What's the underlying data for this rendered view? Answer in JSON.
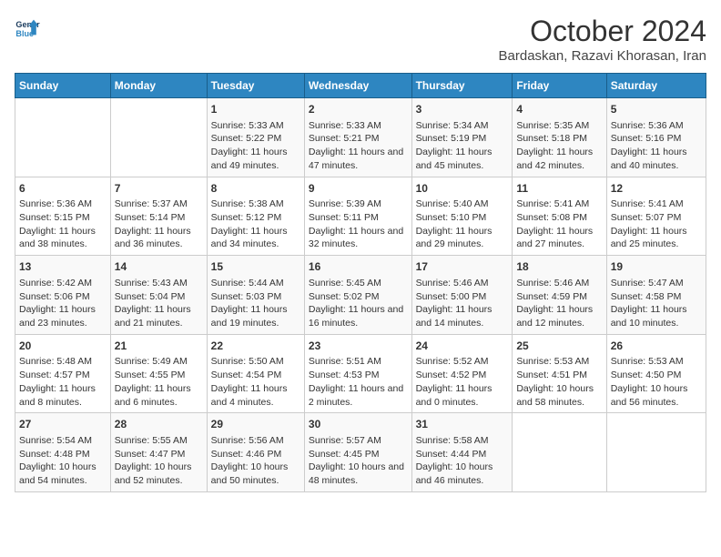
{
  "header": {
    "logo_line1": "General",
    "logo_line2": "Blue",
    "month": "October 2024",
    "location": "Bardaskan, Razavi Khorasan, Iran"
  },
  "weekdays": [
    "Sunday",
    "Monday",
    "Tuesday",
    "Wednesday",
    "Thursday",
    "Friday",
    "Saturday"
  ],
  "weeks": [
    [
      {
        "day": "",
        "content": ""
      },
      {
        "day": "",
        "content": ""
      },
      {
        "day": "1",
        "content": "Sunrise: 5:33 AM\nSunset: 5:22 PM\nDaylight: 11 hours and 49 minutes."
      },
      {
        "day": "2",
        "content": "Sunrise: 5:33 AM\nSunset: 5:21 PM\nDaylight: 11 hours and 47 minutes."
      },
      {
        "day": "3",
        "content": "Sunrise: 5:34 AM\nSunset: 5:19 PM\nDaylight: 11 hours and 45 minutes."
      },
      {
        "day": "4",
        "content": "Sunrise: 5:35 AM\nSunset: 5:18 PM\nDaylight: 11 hours and 42 minutes."
      },
      {
        "day": "5",
        "content": "Sunrise: 5:36 AM\nSunset: 5:16 PM\nDaylight: 11 hours and 40 minutes."
      }
    ],
    [
      {
        "day": "6",
        "content": "Sunrise: 5:36 AM\nSunset: 5:15 PM\nDaylight: 11 hours and 38 minutes."
      },
      {
        "day": "7",
        "content": "Sunrise: 5:37 AM\nSunset: 5:14 PM\nDaylight: 11 hours and 36 minutes."
      },
      {
        "day": "8",
        "content": "Sunrise: 5:38 AM\nSunset: 5:12 PM\nDaylight: 11 hours and 34 minutes."
      },
      {
        "day": "9",
        "content": "Sunrise: 5:39 AM\nSunset: 5:11 PM\nDaylight: 11 hours and 32 minutes."
      },
      {
        "day": "10",
        "content": "Sunrise: 5:40 AM\nSunset: 5:10 PM\nDaylight: 11 hours and 29 minutes."
      },
      {
        "day": "11",
        "content": "Sunrise: 5:41 AM\nSunset: 5:08 PM\nDaylight: 11 hours and 27 minutes."
      },
      {
        "day": "12",
        "content": "Sunrise: 5:41 AM\nSunset: 5:07 PM\nDaylight: 11 hours and 25 minutes."
      }
    ],
    [
      {
        "day": "13",
        "content": "Sunrise: 5:42 AM\nSunset: 5:06 PM\nDaylight: 11 hours and 23 minutes."
      },
      {
        "day": "14",
        "content": "Sunrise: 5:43 AM\nSunset: 5:04 PM\nDaylight: 11 hours and 21 minutes."
      },
      {
        "day": "15",
        "content": "Sunrise: 5:44 AM\nSunset: 5:03 PM\nDaylight: 11 hours and 19 minutes."
      },
      {
        "day": "16",
        "content": "Sunrise: 5:45 AM\nSunset: 5:02 PM\nDaylight: 11 hours and 16 minutes."
      },
      {
        "day": "17",
        "content": "Sunrise: 5:46 AM\nSunset: 5:00 PM\nDaylight: 11 hours and 14 minutes."
      },
      {
        "day": "18",
        "content": "Sunrise: 5:46 AM\nSunset: 4:59 PM\nDaylight: 11 hours and 12 minutes."
      },
      {
        "day": "19",
        "content": "Sunrise: 5:47 AM\nSunset: 4:58 PM\nDaylight: 11 hours and 10 minutes."
      }
    ],
    [
      {
        "day": "20",
        "content": "Sunrise: 5:48 AM\nSunset: 4:57 PM\nDaylight: 11 hours and 8 minutes."
      },
      {
        "day": "21",
        "content": "Sunrise: 5:49 AM\nSunset: 4:55 PM\nDaylight: 11 hours and 6 minutes."
      },
      {
        "day": "22",
        "content": "Sunrise: 5:50 AM\nSunset: 4:54 PM\nDaylight: 11 hours and 4 minutes."
      },
      {
        "day": "23",
        "content": "Sunrise: 5:51 AM\nSunset: 4:53 PM\nDaylight: 11 hours and 2 minutes."
      },
      {
        "day": "24",
        "content": "Sunrise: 5:52 AM\nSunset: 4:52 PM\nDaylight: 11 hours and 0 minutes."
      },
      {
        "day": "25",
        "content": "Sunrise: 5:53 AM\nSunset: 4:51 PM\nDaylight: 10 hours and 58 minutes."
      },
      {
        "day": "26",
        "content": "Sunrise: 5:53 AM\nSunset: 4:50 PM\nDaylight: 10 hours and 56 minutes."
      }
    ],
    [
      {
        "day": "27",
        "content": "Sunrise: 5:54 AM\nSunset: 4:48 PM\nDaylight: 10 hours and 54 minutes."
      },
      {
        "day": "28",
        "content": "Sunrise: 5:55 AM\nSunset: 4:47 PM\nDaylight: 10 hours and 52 minutes."
      },
      {
        "day": "29",
        "content": "Sunrise: 5:56 AM\nSunset: 4:46 PM\nDaylight: 10 hours and 50 minutes."
      },
      {
        "day": "30",
        "content": "Sunrise: 5:57 AM\nSunset: 4:45 PM\nDaylight: 10 hours and 48 minutes."
      },
      {
        "day": "31",
        "content": "Sunrise: 5:58 AM\nSunset: 4:44 PM\nDaylight: 10 hours and 46 minutes."
      },
      {
        "day": "",
        "content": ""
      },
      {
        "day": "",
        "content": ""
      }
    ]
  ]
}
